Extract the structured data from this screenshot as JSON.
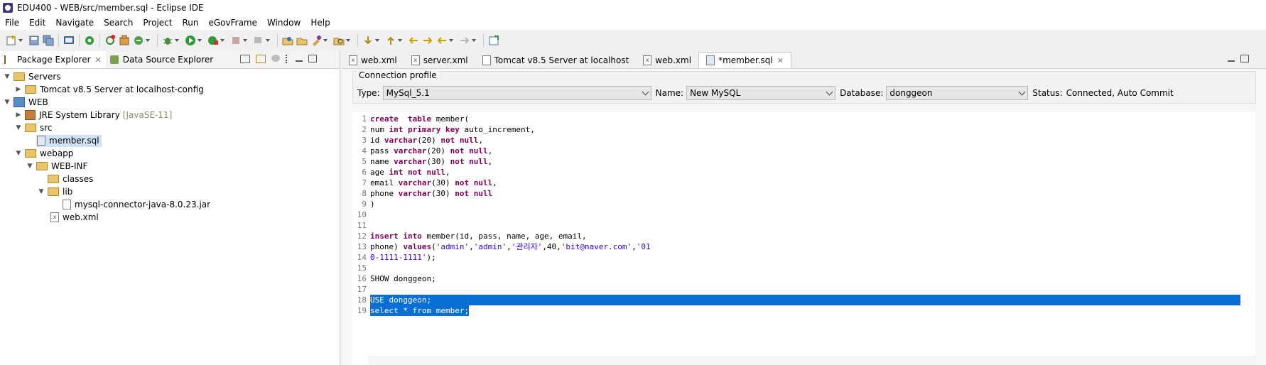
{
  "window": {
    "title": "EDU400 - WEB/src/member.sql - Eclipse IDE"
  },
  "menu": [
    "File",
    "Edit",
    "Navigate",
    "Search",
    "Project",
    "Run",
    "eGovFrame",
    "Window",
    "Help"
  ],
  "left_tabs": [
    {
      "label": "Package Explorer",
      "active": true
    },
    {
      "label": "Data Source Explorer",
      "active": false
    }
  ],
  "tree": [
    {
      "label": "Servers",
      "indent": 0,
      "twisty": "open",
      "icon": "folder-icon"
    },
    {
      "label": "Tomcat v8.5 Server at localhost-config",
      "indent": 1,
      "twisty": "closed",
      "icon": "folder-icon"
    },
    {
      "label": "WEB",
      "indent": 0,
      "twisty": "open",
      "icon": "project-icon"
    },
    {
      "label": "JRE System Library",
      "extra": "[JavaSE-11]",
      "indent": 1,
      "twisty": "closed",
      "icon": "library-icon"
    },
    {
      "label": "src",
      "indent": 1,
      "twisty": "open",
      "icon": "package-folder-icon"
    },
    {
      "label": "member.sql",
      "indent": 2,
      "twisty": "",
      "icon": "sql-file-icon",
      "selected": true
    },
    {
      "label": "webapp",
      "indent": 1,
      "twisty": "open",
      "icon": "folder-icon"
    },
    {
      "label": "WEB-INF",
      "indent": 2,
      "twisty": "open",
      "icon": "folder-icon"
    },
    {
      "label": "classes",
      "indent": 3,
      "twisty": "",
      "icon": "folder-icon"
    },
    {
      "label": "lib",
      "indent": 3,
      "twisty": "open",
      "icon": "folder-icon"
    },
    {
      "label": "mysql-connector-java-8.0.23.jar",
      "indent": 4,
      "twisty": "",
      "icon": "jar-file-icon"
    },
    {
      "label": "web.xml",
      "indent": 3,
      "twisty": "",
      "icon": "xml-file-icon"
    }
  ],
  "editor_tabs": [
    {
      "label": "web.xml",
      "icon": "xml-file-icon",
      "active": false
    },
    {
      "label": "server.xml",
      "icon": "xml-file-icon",
      "active": false
    },
    {
      "label": "Tomcat v8.5 Server at localhost",
      "icon": "server-icon",
      "active": false
    },
    {
      "label": "web.xml",
      "icon": "xml-file-icon",
      "active": false
    },
    {
      "label": "*member.sql",
      "icon": "sql-file-icon",
      "active": true
    }
  ],
  "connection": {
    "group_label": "Connection profile",
    "type_label": "Type:",
    "type_value": "MySql_5.1",
    "name_label": "Name:",
    "name_value": "New MySQL",
    "db_label": "Database:",
    "db_value": "donggeon",
    "status_label": "Status:",
    "status_value": "Connected, Auto Commit"
  },
  "code": [
    {
      "n": "1",
      "t": [
        [
          "kw",
          "create"
        ],
        [
          "",
          "  "
        ],
        [
          "kw",
          "table"
        ],
        [
          "",
          " member("
        ]
      ]
    },
    {
      "n": "2",
      "t": [
        [
          "",
          "num "
        ],
        [
          "kw",
          "int"
        ],
        [
          "",
          ""
        ],
        [
          "",
          " "
        ],
        [
          "kw",
          "primary key"
        ],
        [
          "",
          " auto_increment,"
        ]
      ]
    },
    {
      "n": "3",
      "t": [
        [
          "",
          "id "
        ],
        [
          "kw",
          "varchar"
        ],
        [
          "",
          "(20) "
        ],
        [
          "kw",
          "not null"
        ],
        [
          "",
          ","
        ]
      ]
    },
    {
      "n": "4",
      "t": [
        [
          "",
          "pass "
        ],
        [
          "kw",
          "varchar"
        ],
        [
          "",
          "(20) "
        ],
        [
          "kw",
          "not null"
        ],
        [
          "",
          ","
        ]
      ]
    },
    {
      "n": "5",
      "t": [
        [
          "",
          "name "
        ],
        [
          "kw",
          "varchar"
        ],
        [
          "",
          "(30) "
        ],
        [
          "kw",
          "not null"
        ],
        [
          "",
          ","
        ]
      ]
    },
    {
      "n": "6",
      "t": [
        [
          "",
          "age "
        ],
        [
          "kw",
          "int"
        ],
        [
          "",
          " "
        ],
        [
          "kw",
          "not null"
        ],
        [
          "",
          ","
        ]
      ]
    },
    {
      "n": "7",
      "t": [
        [
          "",
          "email "
        ],
        [
          "kw",
          "varchar"
        ],
        [
          "",
          "(30) "
        ],
        [
          "kw",
          "not null"
        ],
        [
          "",
          ","
        ]
      ]
    },
    {
      "n": "8",
      "t": [
        [
          "",
          "phone "
        ],
        [
          "kw",
          "varchar"
        ],
        [
          "",
          "(30) "
        ],
        [
          "kw",
          "not null"
        ]
      ]
    },
    {
      "n": "9",
      "t": [
        [
          "",
          ")"
        ]
      ]
    },
    {
      "n": "10",
      "t": []
    },
    {
      "n": "11",
      "t": []
    },
    {
      "n": "12",
      "t": [
        [
          "kw",
          "insert"
        ],
        [
          "",
          " "
        ],
        [
          "kw",
          "into"
        ],
        [
          "",
          " member(id, pass, name, age, email,"
        ]
      ]
    },
    {
      "n": "13",
      "t": [
        [
          "",
          "phone) "
        ],
        [
          "kw",
          "values"
        ],
        [
          "",
          "("
        ],
        [
          "str",
          "'admin'"
        ],
        [
          "",
          ","
        ],
        [
          "str",
          "'admin'"
        ],
        [
          "",
          ","
        ],
        [
          "str",
          "'관리자'"
        ],
        [
          "",
          ",40,"
        ],
        [
          "str",
          "'bit@naver.com'"
        ],
        [
          "",
          ","
        ],
        [
          "str",
          "'01"
        ]
      ]
    },
    {
      "n": "",
      "t": [
        [
          "str",
          "0-1111-1111'"
        ],
        [
          "",
          ");"
        ]
      ]
    },
    {
      "n": "15",
      "t": []
    },
    {
      "n": "16",
      "t": [
        [
          "",
          "SHOW donggeon;"
        ]
      ]
    },
    {
      "n": "17",
      "t": []
    },
    {
      "n": "18",
      "t": [
        [
          "",
          "USE donggeon;"
        ]
      ],
      "hl": true
    },
    {
      "n": "19",
      "t": [
        [
          "",
          "select * from member;"
        ]
      ],
      "hl": true,
      "partial": true
    }
  ],
  "line14": "14"
}
